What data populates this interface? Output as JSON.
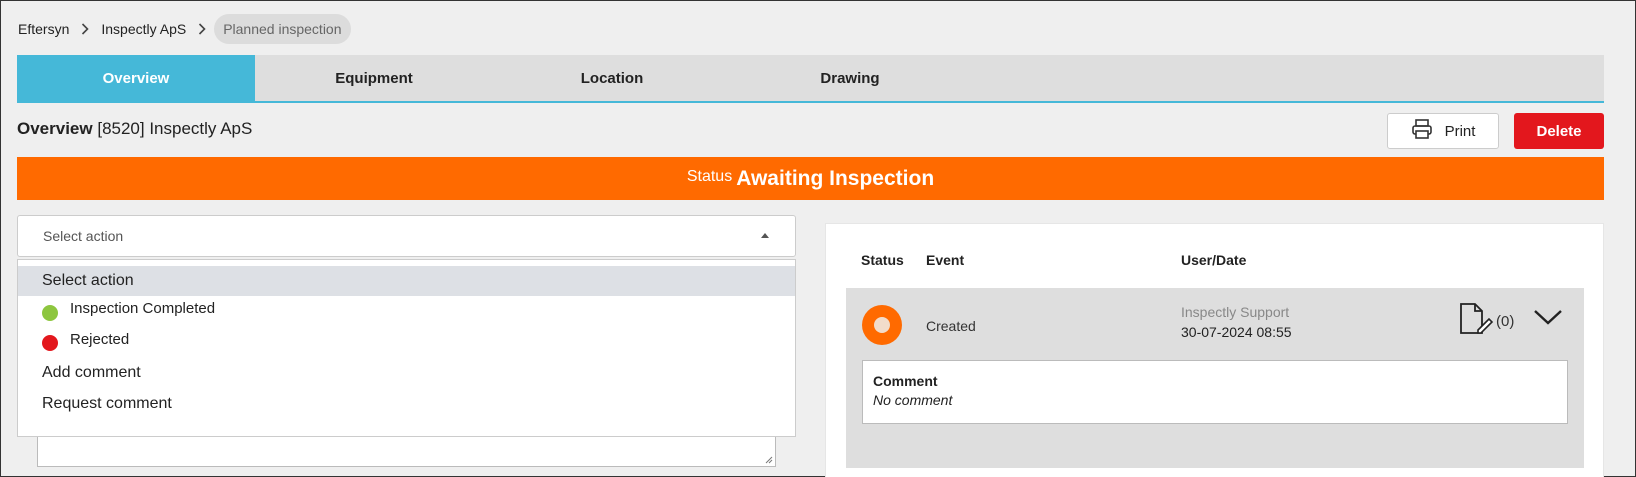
{
  "breadcrumb": {
    "items": [
      "Eftersyn",
      "Inspectly ApS"
    ],
    "current": "Planned inspection"
  },
  "tabs": [
    {
      "label": "Overview",
      "active": true
    },
    {
      "label": "Equipment",
      "active": false
    },
    {
      "label": "Location",
      "active": false
    },
    {
      "label": "Drawing",
      "active": false
    }
  ],
  "header": {
    "title": "Overview",
    "subtitle": "[8520] Inspectly ApS",
    "print_label": "Print",
    "delete_label": "Delete"
  },
  "status": {
    "label": "Status",
    "value": "Awaiting Inspection",
    "color": "#ff6a00"
  },
  "action_select": {
    "placeholder": "Select action",
    "options": [
      {
        "label": "Select action",
        "highlighted": true
      },
      {
        "label": "Inspection Completed",
        "dot_color": "#8dc63f"
      },
      {
        "label": "Rejected",
        "dot_color": "#e3171d"
      },
      {
        "label": "Add comment"
      },
      {
        "label": "Request comment"
      }
    ]
  },
  "history": {
    "columns": [
      "Status",
      "Event",
      "User/Date"
    ],
    "rows": [
      {
        "event": "Created",
        "user": "Inspectly Support",
        "date": "30-07-2024 08:55",
        "attachments": "(0)",
        "comment_title": "Comment",
        "comment_value": "No comment"
      }
    ]
  },
  "colors": {
    "accent": "#45b8d8",
    "danger": "#e3171d",
    "status": "#ff6a00"
  }
}
